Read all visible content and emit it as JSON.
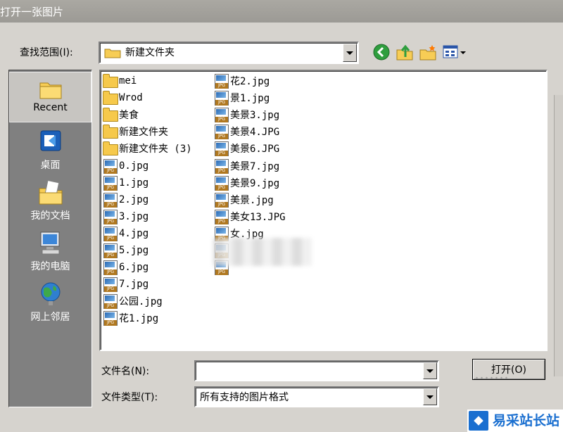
{
  "window": {
    "title": "打开一张图片"
  },
  "toolbar": {
    "look_in_label": "查找范围(I):",
    "look_in_value": "新建文件夹",
    "icons": [
      "back-icon",
      "up-folder-icon",
      "new-folder-icon",
      "view-menu-icon"
    ]
  },
  "places": [
    {
      "label": "Recent",
      "icon": "recent-folder-icon",
      "selected": true
    },
    {
      "label": "桌面",
      "icon": "desktop-icon"
    },
    {
      "label": "我的文档",
      "icon": "my-documents-icon"
    },
    {
      "label": "我的电脑",
      "icon": "my-computer-icon"
    },
    {
      "label": "网上邻居",
      "icon": "network-icon"
    }
  ],
  "files": {
    "col1": [
      {
        "name": "mei",
        "type": "folder"
      },
      {
        "name": "Wrod",
        "type": "folder"
      },
      {
        "name": "美食",
        "type": "folder"
      },
      {
        "name": "新建文件夹",
        "type": "folder"
      },
      {
        "name": "新建文件夹 (3)",
        "type": "folder"
      },
      {
        "name": "0.jpg",
        "type": "jpg"
      },
      {
        "name": "1.jpg",
        "type": "jpg"
      },
      {
        "name": "2.jpg",
        "type": "jpg"
      },
      {
        "name": "3.jpg",
        "type": "jpg"
      },
      {
        "name": "4.jpg",
        "type": "jpg"
      },
      {
        "name": "5.jpg",
        "type": "jpg"
      },
      {
        "name": "6.jpg",
        "type": "jpg"
      },
      {
        "name": "7.jpg",
        "type": "jpg"
      },
      {
        "name": "公园.jpg",
        "type": "jpg"
      },
      {
        "name": "花1.jpg",
        "type": "jpg"
      }
    ],
    "col2": [
      {
        "name": "花2.jpg",
        "type": "jpg"
      },
      {
        "name": "景1.jpg",
        "type": "jpg"
      },
      {
        "name": "美景3.jpg",
        "type": "jpg"
      },
      {
        "name": "美景4.JPG",
        "type": "jpg"
      },
      {
        "name": "美景6.JPG",
        "type": "jpg"
      },
      {
        "name": "美景7.jpg",
        "type": "jpg"
      },
      {
        "name": "美景9.jpg",
        "type": "jpg"
      },
      {
        "name": "美景.jpg",
        "type": "jpg"
      },
      {
        "name": "美女13.JPG",
        "type": "jpg"
      },
      {
        "name": "女.jpg",
        "type": "jpg"
      },
      {
        "name": "",
        "type": "jpg"
      },
      {
        "name": "",
        "type": "jpg"
      }
    ]
  },
  "footer": {
    "filename_label": "文件名(N):",
    "filename_value": "",
    "filetype_label": "文件类型(T):",
    "filetype_value": "所有支持的图片格式",
    "open_button": "打开(O)"
  },
  "watermark": {
    "text": "易采站长站"
  }
}
